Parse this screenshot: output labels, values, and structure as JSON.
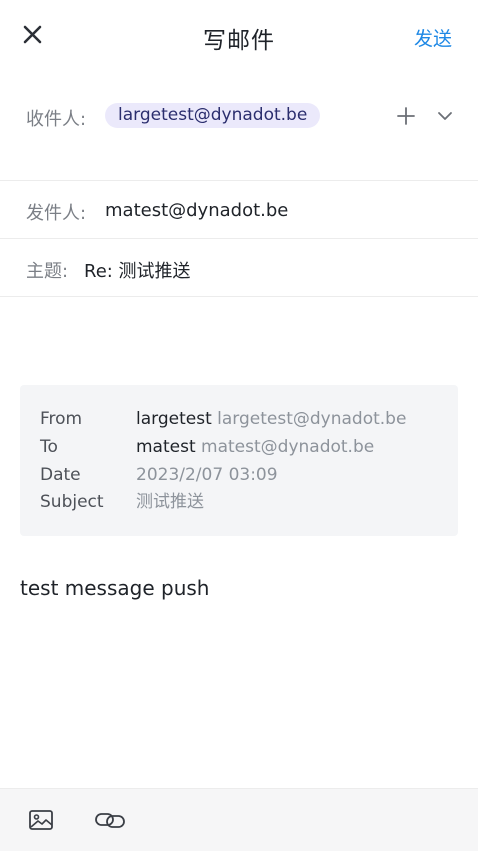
{
  "header": {
    "title": "写邮件",
    "send_label": "发送"
  },
  "recipients": {
    "label": "收件人:",
    "chips": [
      "largetest@dynadot.be"
    ]
  },
  "sender": {
    "label": "发件人:",
    "value": "matest@dynadot.be"
  },
  "subject": {
    "label": "主题:",
    "value": "Re: 测试推送"
  },
  "quoted": {
    "from_key": "From",
    "from_name": "largetest",
    "from_email": "largetest@dynadot.be",
    "to_key": "To",
    "to_name": "matest",
    "to_email": "matest@dynadot.be",
    "date_key": "Date",
    "date_value": "2023/2/07 03:09",
    "subject_key": "Subject",
    "subject_value": "测试推送"
  },
  "body": {
    "text": "test message push"
  },
  "toolbar": {
    "icons": [
      "image-icon",
      "link-icon"
    ]
  },
  "colors": {
    "accent": "#1e88e5",
    "chip_bg": "#ebe9fb",
    "quote_bg": "#f4f5f7"
  }
}
